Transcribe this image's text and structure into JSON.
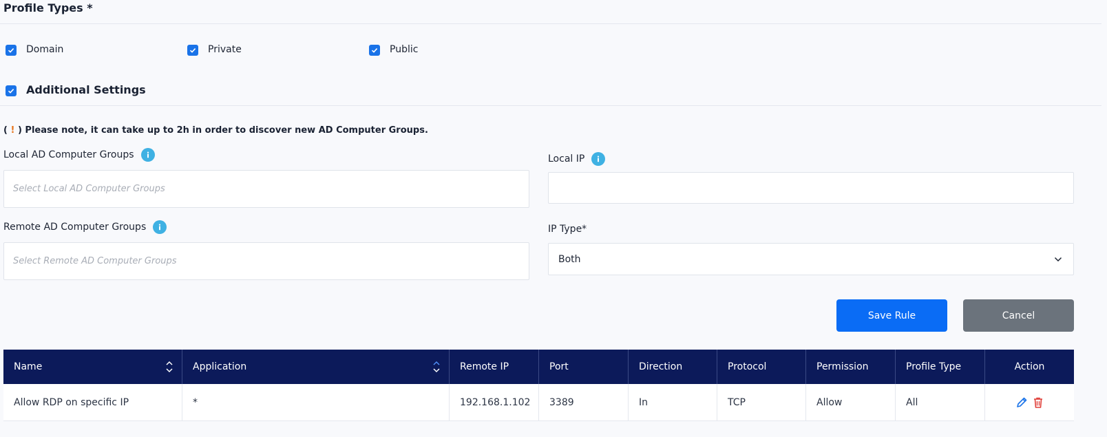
{
  "profile_types": {
    "title": "Profile Types *",
    "options": [
      {
        "label": "Domain",
        "checked": true
      },
      {
        "label": "Private",
        "checked": true
      },
      {
        "label": "Public",
        "checked": true
      }
    ]
  },
  "additional_settings": {
    "title": "Additional Settings",
    "checked": true
  },
  "note": {
    "open": "(",
    "mark": "!",
    "text": ") Please note, it can take up to 2h in order to discover new AD Computer Groups."
  },
  "form": {
    "local_ad_groups": {
      "label": "Local AD Computer Groups",
      "placeholder": "Select Local AD Computer Groups"
    },
    "remote_ad_groups": {
      "label": "Remote AD Computer Groups",
      "placeholder": "Select Remote AD Computer Groups"
    },
    "local_ip": {
      "label": "Local IP",
      "value": ""
    },
    "ip_type": {
      "label": "IP Type*",
      "value": "Both"
    }
  },
  "buttons": {
    "save": "Save Rule",
    "cancel": "Cancel"
  },
  "table": {
    "headers": [
      "Name",
      "Application",
      "Remote IP",
      "Port",
      "Direction",
      "Protocol",
      "Permission",
      "Profile Type",
      "Action"
    ],
    "rows": [
      {
        "name": "Allow RDP on specific IP",
        "application": "*",
        "remote_ip": "192.168.1.102",
        "port": "3389",
        "direction": "In",
        "protocol": "TCP",
        "permission": "Allow",
        "profile_type": "All"
      }
    ]
  },
  "colors": {
    "accent": "#1a73e8",
    "header_bg": "#0c1a5a",
    "save_button": "#0a6cf5",
    "cancel_button": "#6b737c",
    "info_icon": "#3fb1e3",
    "edit_icon": "#1a73e8",
    "delete_icon": "#e0403a"
  }
}
